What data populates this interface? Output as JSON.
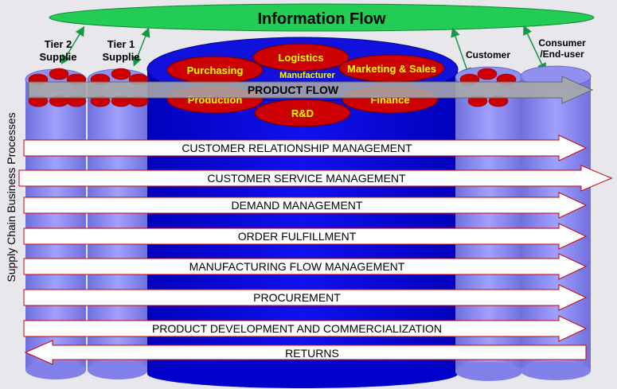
{
  "info_flow": {
    "label": "Information Flow",
    "color": "#22cc55"
  },
  "actors": {
    "tier2": {
      "line1": "Tier 2",
      "line2": "Supplie"
    },
    "tier1": {
      "line1": "Tier 1",
      "line2": "Supplie"
    },
    "customer": {
      "label": "Customer"
    },
    "consumer": {
      "line1": "Consumer",
      "line2": "/End-user"
    }
  },
  "manufacturer": {
    "label": "Manufacturer",
    "functions": {
      "logistics": "Logistics",
      "purchasing": "Purchasing",
      "marketing": "Marketing & Sales",
      "production": "Production",
      "finance": "Finance",
      "rnd": "R&D"
    }
  },
  "product_flow": {
    "label": "PRODUCT FLOW"
  },
  "side_label": "Supply Chain Business Processes",
  "processes": [
    {
      "label": "CUSTOMER RELATIONSHIP MANAGEMENT",
      "direction": "right"
    },
    {
      "label": "CUSTOMER SERVICE MANAGEMENT",
      "direction": "right"
    },
    {
      "label": "DEMAND MANAGEMENT",
      "direction": "right"
    },
    {
      "label": "ORDER FULFILLMENT",
      "direction": "right"
    },
    {
      "label": "MANUFACTURING FLOW MANAGEMENT",
      "direction": "right"
    },
    {
      "label": "PROCUREMENT",
      "direction": "right"
    },
    {
      "label": "PRODUCT DEVELOPMENT AND COMMERCIALIZATION",
      "direction": "right"
    },
    {
      "label": "RETURNS",
      "direction": "left"
    }
  ],
  "colors": {
    "column": "#8888ee",
    "manufacturer_body": "#0000dd",
    "function_oval": "#cc0000",
    "function_text": "#ffff00",
    "arrow_stroke": "#cc0000"
  }
}
